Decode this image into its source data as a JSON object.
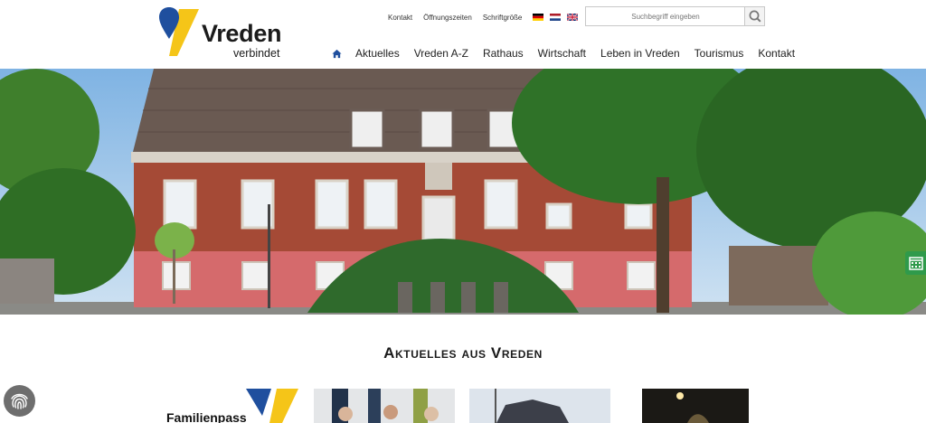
{
  "logo": {
    "brand": "Vreden",
    "tagline": "verbindet"
  },
  "topbar": {
    "links": [
      "Kontakt",
      "Öffnungszeiten",
      "Schriftgröße"
    ],
    "flags": [
      "flag-de-icon",
      "flag-nl-icon",
      "flag-uk-icon"
    ]
  },
  "search": {
    "placeholder": "Suchbegriff eingeben"
  },
  "nav": {
    "items": [
      "Aktuelles",
      "Vreden A-Z",
      "Rathaus",
      "Wirtschaft",
      "Leben in Vreden",
      "Tourismus",
      "Kontakt"
    ]
  },
  "section": {
    "title": "Aktuelles aus Vreden"
  },
  "cards": [
    {
      "text": "Familienpass"
    }
  ],
  "colors": {
    "brand_blue": "#1f4f9e",
    "brand_yellow": "#f5c518",
    "calendar_green": "#2f9a4b",
    "fingerprint_gray": "#6e6e6e"
  }
}
